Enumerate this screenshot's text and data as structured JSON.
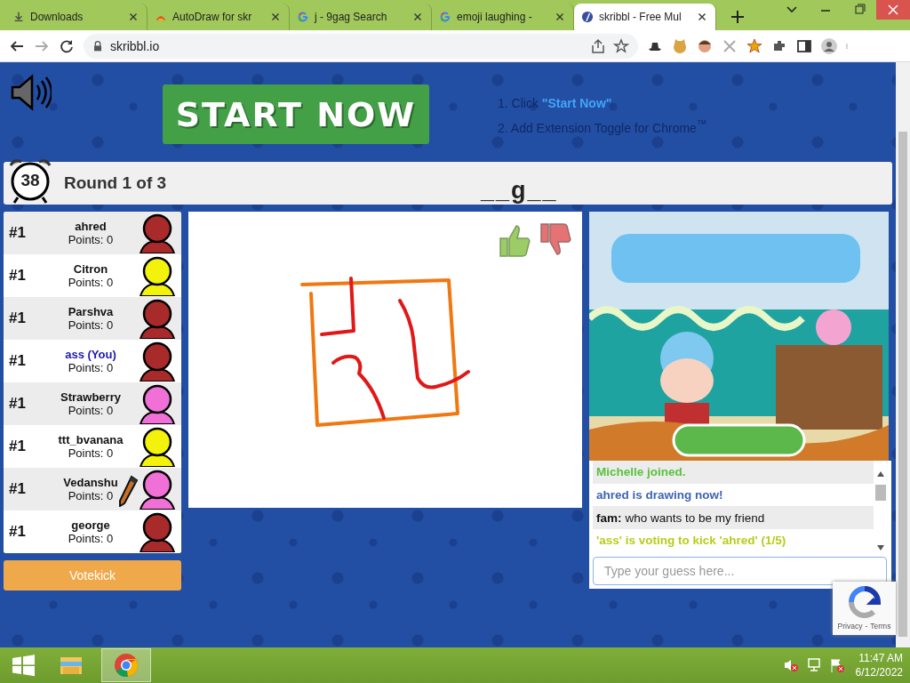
{
  "browser": {
    "tabs": [
      {
        "title": "Downloads",
        "selected": false
      },
      {
        "title": "AutoDraw for skr",
        "selected": false
      },
      {
        "title": "j - 9gag Search",
        "selected": false
      },
      {
        "title": "emoji laughing - ",
        "selected": false
      },
      {
        "title": "skribbl - Free Mul",
        "selected": true
      }
    ],
    "address": "skribbl.io"
  },
  "promo": {
    "button": "START NOW",
    "steps": [
      {
        "prefix": "1. Click ",
        "link": "\"Start Now\""
      },
      {
        "prefix": "2. Add Extension Toggle for Chrome",
        "suffix": "™"
      }
    ]
  },
  "header": {
    "timer": "38",
    "round": "Round 1 of 3",
    "word": "__g__"
  },
  "players": [
    {
      "rank": "#1",
      "name": "ahred",
      "points": "Points: 0",
      "you": false,
      "drawing": false,
      "color": "#a82a2a"
    },
    {
      "rank": "#1",
      "name": "Citron",
      "points": "Points: 0",
      "you": false,
      "drawing": false,
      "color": "#f2f20c"
    },
    {
      "rank": "#1",
      "name": "Parshva",
      "points": "Points: 0",
      "you": false,
      "drawing": false,
      "color": "#a82a2a"
    },
    {
      "rank": "#1",
      "name": "ass (You)",
      "points": "Points: 0",
      "you": true,
      "drawing": false,
      "color": "#a82a2a"
    },
    {
      "rank": "#1",
      "name": "Strawberry",
      "points": "Points: 0",
      "you": false,
      "drawing": false,
      "color": "#f070d8"
    },
    {
      "rank": "#1",
      "name": "ttt_bvanana",
      "points": "Points: 0",
      "you": false,
      "drawing": false,
      "color": "#f2f20c"
    },
    {
      "rank": "#1",
      "name": "Vedanshu",
      "points": "Points: 0",
      "you": false,
      "drawing": true,
      "color": "#f070d8"
    },
    {
      "rank": "#1",
      "name": "george",
      "points": "Points: 0",
      "you": false,
      "drawing": false,
      "color": "#a82a2a"
    }
  ],
  "votekick": "Votekick",
  "chat": {
    "messages": [
      {
        "kind": "join",
        "text": "Michelle joined."
      },
      {
        "kind": "drawing",
        "text": "ahred is drawing now!"
      },
      {
        "kind": "message",
        "author": "fam:",
        "text": "who wants to be my friend"
      },
      {
        "kind": "vote",
        "text": "'ass' is voting to kick 'ahred' (1/5)"
      }
    ],
    "placeholder": "Type your guess here..."
  },
  "recaptcha": {
    "privacy": "Privacy",
    "separator": "-",
    "terms": "Terms"
  },
  "taskbar": {
    "time": "11:47 AM",
    "date": "6/12/2022"
  }
}
